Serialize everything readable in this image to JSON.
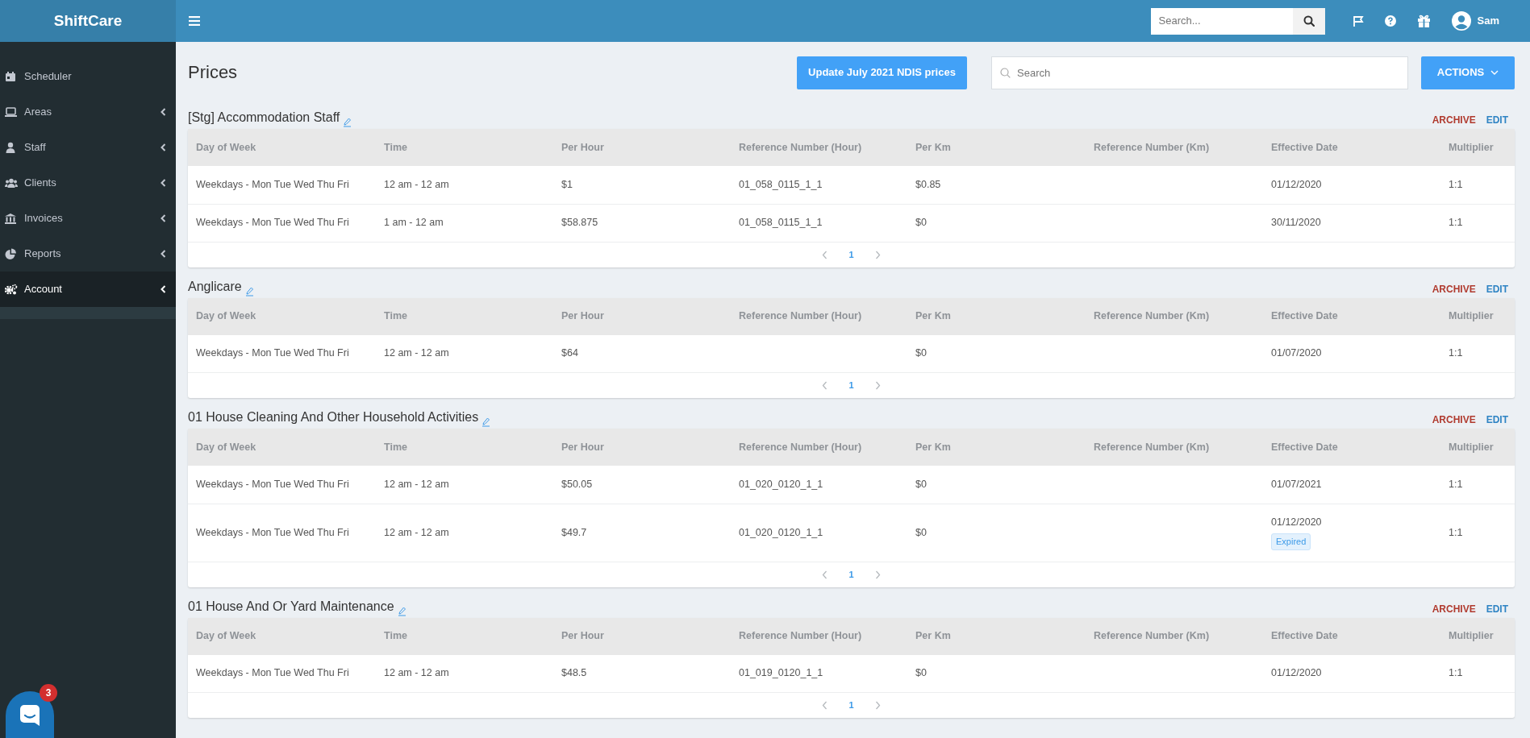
{
  "brand": "ShiftCare",
  "topbar": {
    "search": {
      "placeholder": "Search..."
    },
    "user": "Sam"
  },
  "sidebar": {
    "items": [
      {
        "label": "Scheduler",
        "expandable": false,
        "selected": false
      },
      {
        "label": "Areas",
        "expandable": true,
        "selected": false
      },
      {
        "label": "Staff",
        "expandable": true,
        "selected": false
      },
      {
        "label": "Clients",
        "expandable": true,
        "selected": false
      },
      {
        "label": "Invoices",
        "expandable": true,
        "selected": false
      },
      {
        "label": "Reports",
        "expandable": true,
        "selected": false
      },
      {
        "label": "Account",
        "expandable": true,
        "selected": true
      }
    ]
  },
  "page": {
    "title": "Prices",
    "update_button": "Update July 2021 NDIS prices",
    "search": {
      "placeholder": "Search"
    },
    "actions_button": "ACTIONS"
  },
  "sections": [
    {
      "title": "[Stg] Accommodation Staff",
      "archive": "ARCHIVE",
      "edit": "EDIT",
      "columns": [
        "Day of Week",
        "Time",
        "Per Hour",
        "Reference Number (Hour)",
        "Per Km",
        "Reference Number (Km)",
        "Effective Date",
        "Multiplier"
      ],
      "rows": [
        {
          "day": "Weekdays - Mon Tue Wed Thu Fri",
          "time": "12 am - 12 am",
          "per_hour": "$1",
          "ref_hour": "01_058_0115_1_1",
          "per_km": "$0.85",
          "effective_date": "01/12/2020",
          "multiplier": "1:1"
        },
        {
          "day": "Weekdays - Mon Tue Wed Thu Fri",
          "time": "1 am - 12 am",
          "per_hour": "$58.875",
          "ref_hour": "01_058_0115_1_1",
          "per_km": "$0",
          "effective_date": "30/11/2020",
          "multiplier": "1:1"
        }
      ],
      "pagination": {
        "page": "1"
      }
    },
    {
      "title": "Anglicare",
      "archive": "ARCHIVE",
      "edit": "EDIT",
      "columns": [
        "Day of Week",
        "Time",
        "Per Hour",
        "Reference Number (Hour)",
        "Per Km",
        "Reference Number (Km)",
        "Effective Date",
        "Multiplier"
      ],
      "rows": [
        {
          "day": "Weekdays - Mon Tue Wed Thu Fri",
          "time": "12 am - 12 am",
          "per_hour": "$64",
          "per_km": "$0",
          "effective_date": "01/07/2020",
          "multiplier": "1:1"
        }
      ],
      "pagination": {
        "page": "1"
      }
    },
    {
      "title": "01 House Cleaning And Other Household Activities",
      "archive": "ARCHIVE",
      "edit": "EDIT",
      "columns": [
        "Day of Week",
        "Time",
        "Per Hour",
        "Reference Number (Hour)",
        "Per Km",
        "Reference Number (Km)",
        "Effective Date",
        "Multiplier"
      ],
      "rows": [
        {
          "day": "Weekdays - Mon Tue Wed Thu Fri",
          "time": "12 am - 12 am",
          "per_hour": "$50.05",
          "ref_hour": "01_020_0120_1_1",
          "per_km": "$0",
          "effective_date": "01/07/2021",
          "multiplier": "1:1"
        },
        {
          "day": "Weekdays - Mon Tue Wed Thu Fri",
          "time": "12 am - 12 am",
          "per_hour": "$49.7",
          "ref_hour": "01_020_0120_1_1",
          "per_km": "$0",
          "effective_date": "01/12/2020",
          "status": "Expired",
          "multiplier": "1:1"
        }
      ],
      "pagination": {
        "page": "1"
      }
    },
    {
      "title": "01 House And Or Yard Maintenance",
      "archive": "ARCHIVE",
      "edit": "EDIT",
      "columns": [
        "Day of Week",
        "Time",
        "Per Hour",
        "Reference Number (Hour)",
        "Per Km",
        "Reference Number (Km)",
        "Effective Date",
        "Multiplier"
      ],
      "rows": [
        {
          "day": "Weekdays - Mon Tue Wed Thu Fri",
          "time": "12 am - 12 am",
          "per_hour": "$48.5",
          "ref_hour": "01_019_0120_1_1",
          "per_km": "$0",
          "effective_date": "01/12/2020",
          "multiplier": "1:1"
        }
      ],
      "pagination": {
        "page": "1"
      }
    }
  ],
  "chat": {
    "badge": "3"
  }
}
